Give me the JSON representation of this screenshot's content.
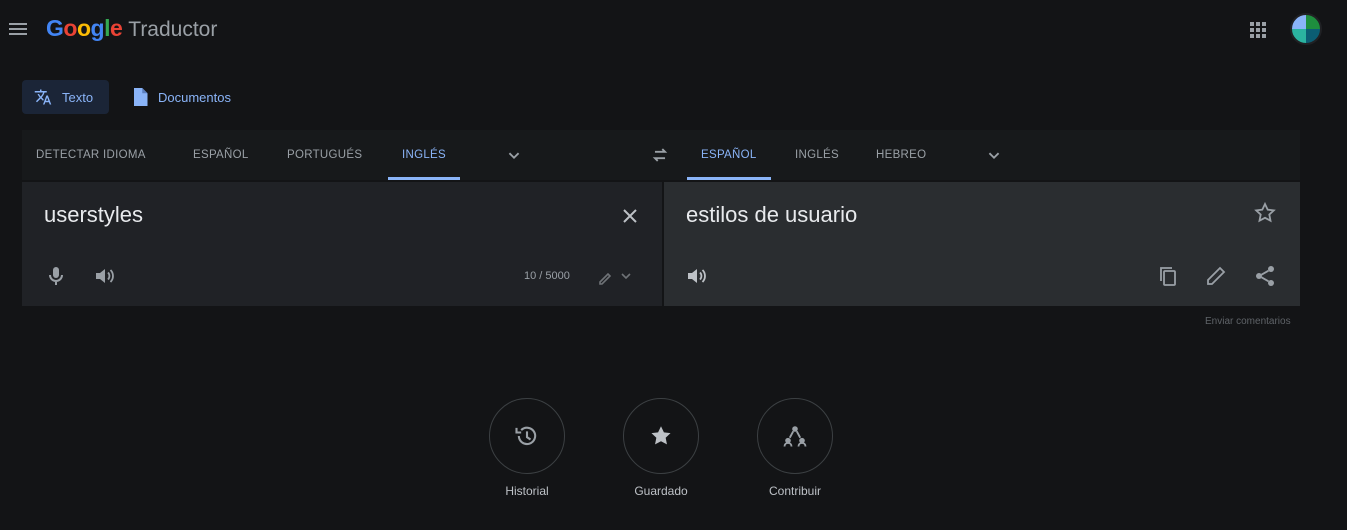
{
  "header": {
    "logo_google_letters": [
      "G",
      "o",
      "o",
      "g",
      "l",
      "e"
    ],
    "logo_product": "Traductor",
    "icons": {
      "menu": "hamburger-menu-icon",
      "apps": "apps-grid-icon",
      "avatar": "account-avatar"
    }
  },
  "modes": {
    "text_label": "Texto",
    "documents_label": "Documentos",
    "icons": {
      "text": "translate-icon",
      "documents": "document-icon"
    }
  },
  "source_langs": [
    "DETECTAR IDIOMA",
    "ESPAÑOL",
    "PORTUGUÉS",
    "INGLÉS"
  ],
  "source_active": "INGLÉS",
  "target_langs": [
    "ESPAÑOL",
    "INGLÉS",
    "HEBREO"
  ],
  "target_active": "ESPAÑOL",
  "source": {
    "text": "userstyles",
    "char_count": "10 / 5000",
    "icons": [
      "microphone-icon",
      "speaker-icon",
      "clear-icon",
      "handwriting-icon"
    ]
  },
  "target": {
    "text": "estilos de usuario",
    "icons": [
      "star-icon",
      "speaker-icon",
      "copy-icon",
      "edit-icon",
      "share-icon"
    ]
  },
  "feedback_label": "Enviar comentarios",
  "bottom_actions": [
    {
      "label": "Historial",
      "icon": "history-icon"
    },
    {
      "label": "Guardado",
      "icon": "star-filled-icon"
    },
    {
      "label": "Contribuir",
      "icon": "contribute-icon"
    }
  ],
  "colors": {
    "background": "#131416",
    "accent": "#8ab4f8",
    "source_panel": "#202226",
    "target_panel": "#2a2d30"
  }
}
